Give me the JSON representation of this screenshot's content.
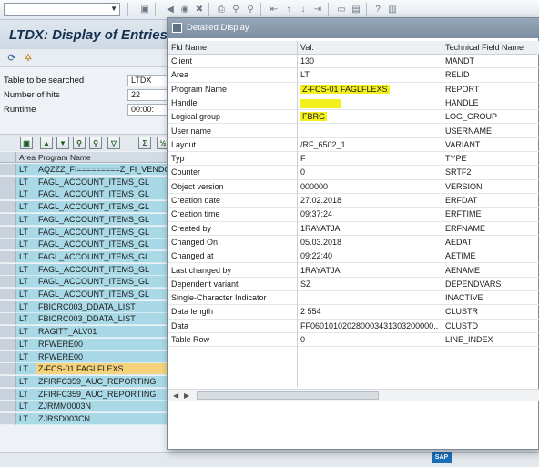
{
  "command_field": {
    "value": ""
  },
  "title": "LTDX: Display of Entries Fo",
  "selection": {
    "fields": [
      {
        "label": "Table to be searched",
        "value": "LTDX"
      },
      {
        "label": "Number of hits",
        "value": "22"
      },
      {
        "label": "Runtime",
        "value": "00:00:"
      }
    ]
  },
  "grid": {
    "headers": {
      "area": "Area",
      "program": "Program Name"
    },
    "rows": [
      {
        "area": "LT",
        "program": "AQZZZ_FI=========Z_FI_VENDO"
      },
      {
        "area": "LT",
        "program": "FAGL_ACCOUNT_ITEMS_GL"
      },
      {
        "area": "LT",
        "program": "FAGL_ACCOUNT_ITEMS_GL"
      },
      {
        "area": "LT",
        "program": "FAGL_ACCOUNT_ITEMS_GL"
      },
      {
        "area": "LT",
        "program": "FAGL_ACCOUNT_ITEMS_GL"
      },
      {
        "area": "LT",
        "program": "FAGL_ACCOUNT_ITEMS_GL"
      },
      {
        "area": "LT",
        "program": "FAGL_ACCOUNT_ITEMS_GL"
      },
      {
        "area": "LT",
        "program": "FAGL_ACCOUNT_ITEMS_GL"
      },
      {
        "area": "LT",
        "program": "FAGL_ACCOUNT_ITEMS_GL"
      },
      {
        "area": "LT",
        "program": "FAGL_ACCOUNT_ITEMS_GL"
      },
      {
        "area": "LT",
        "program": "FAGL_ACCOUNT_ITEMS_GL"
      },
      {
        "area": "LT",
        "program": "FBICRC003_DDATA_LIST"
      },
      {
        "area": "LT",
        "program": "FBICRC003_DDATA_LIST"
      },
      {
        "area": "LT",
        "program": "RAGITT_ALV01"
      },
      {
        "area": "LT",
        "program": "RFWERE00"
      },
      {
        "area": "LT",
        "program": "RFWERE00"
      },
      {
        "area": "LT",
        "program": "Z-FCS-01    FAGLFLEXS"
      },
      {
        "area": "LT",
        "program": "ZFIRFC359_AUC_REPORTING"
      },
      {
        "area": "LT",
        "program": "ZFIRFC359_AUC_REPORTING"
      },
      {
        "area": "LT",
        "program": "ZJRMM0003N"
      },
      {
        "area": "LT",
        "program": "ZJRSD003CN"
      }
    ],
    "selected_index": 16
  },
  "popup": {
    "title": "Detailed Display",
    "headers": {
      "field": "Fld Name",
      "value": "Val.",
      "tech": "Technical Field Name"
    },
    "rows": [
      {
        "field": "Client",
        "value": "130",
        "tech": "MANDT"
      },
      {
        "field": "Area",
        "value": "LT",
        "tech": "RELID"
      },
      {
        "field": "Program Name",
        "value": "Z-FCS-01    FAGLFLEXS",
        "tech": "REPORT"
      },
      {
        "field": "Handle",
        "value": "",
        "tech": "HANDLE"
      },
      {
        "field": "Logical group",
        "value": "FBRG",
        "tech": "LOG_GROUP"
      },
      {
        "field": "User name",
        "value": "",
        "tech": "USERNAME"
      },
      {
        "field": "Layout",
        "value": "/RF_6502_1",
        "tech": "VARIANT"
      },
      {
        "field": "Typ",
        "value": "F",
        "tech": "TYPE"
      },
      {
        "field": "Counter",
        "value": "0",
        "tech": "SRTF2"
      },
      {
        "field": "Object version",
        "value": "000000",
        "tech": "VERSION"
      },
      {
        "field": "Creation date",
        "value": "27.02.2018",
        "tech": "ERFDAT"
      },
      {
        "field": "Creation time",
        "value": "09:37:24",
        "tech": "ERFTIME"
      },
      {
        "field": "Created by",
        "value": "1RAYATJA",
        "tech": "ERFNAME"
      },
      {
        "field": "Changed On",
        "value": "05.03.2018",
        "tech": "AEDAT"
      },
      {
        "field": "Changed at",
        "value": "09:22:40",
        "tech": "AETIME"
      },
      {
        "field": "Last changed by",
        "value": "1RAYATJA",
        "tech": "AENAME"
      },
      {
        "field": "Dependent variant",
        "value": "SZ",
        "tech": "DEPENDVARS"
      },
      {
        "field": "Single-Character Indicator",
        "value": "",
        "tech": "INACTIVE"
      },
      {
        "field": "Data length",
        "value": "2 554",
        "tech": "CLUSTR"
      },
      {
        "field": "Data",
        "value": "FF060101020280003431303200000..",
        "tech": "CLUSTD"
      },
      {
        "field": "Table Row",
        "value": "0",
        "tech": "LINE_INDEX"
      }
    ],
    "highlighted_rows": [
      2,
      3,
      4
    ]
  },
  "sap_logo": "SAP",
  "colors": {
    "row_bg": "#a9d9e6",
    "selected_row": "#f5d37c",
    "highlight": "#f3f01e"
  }
}
